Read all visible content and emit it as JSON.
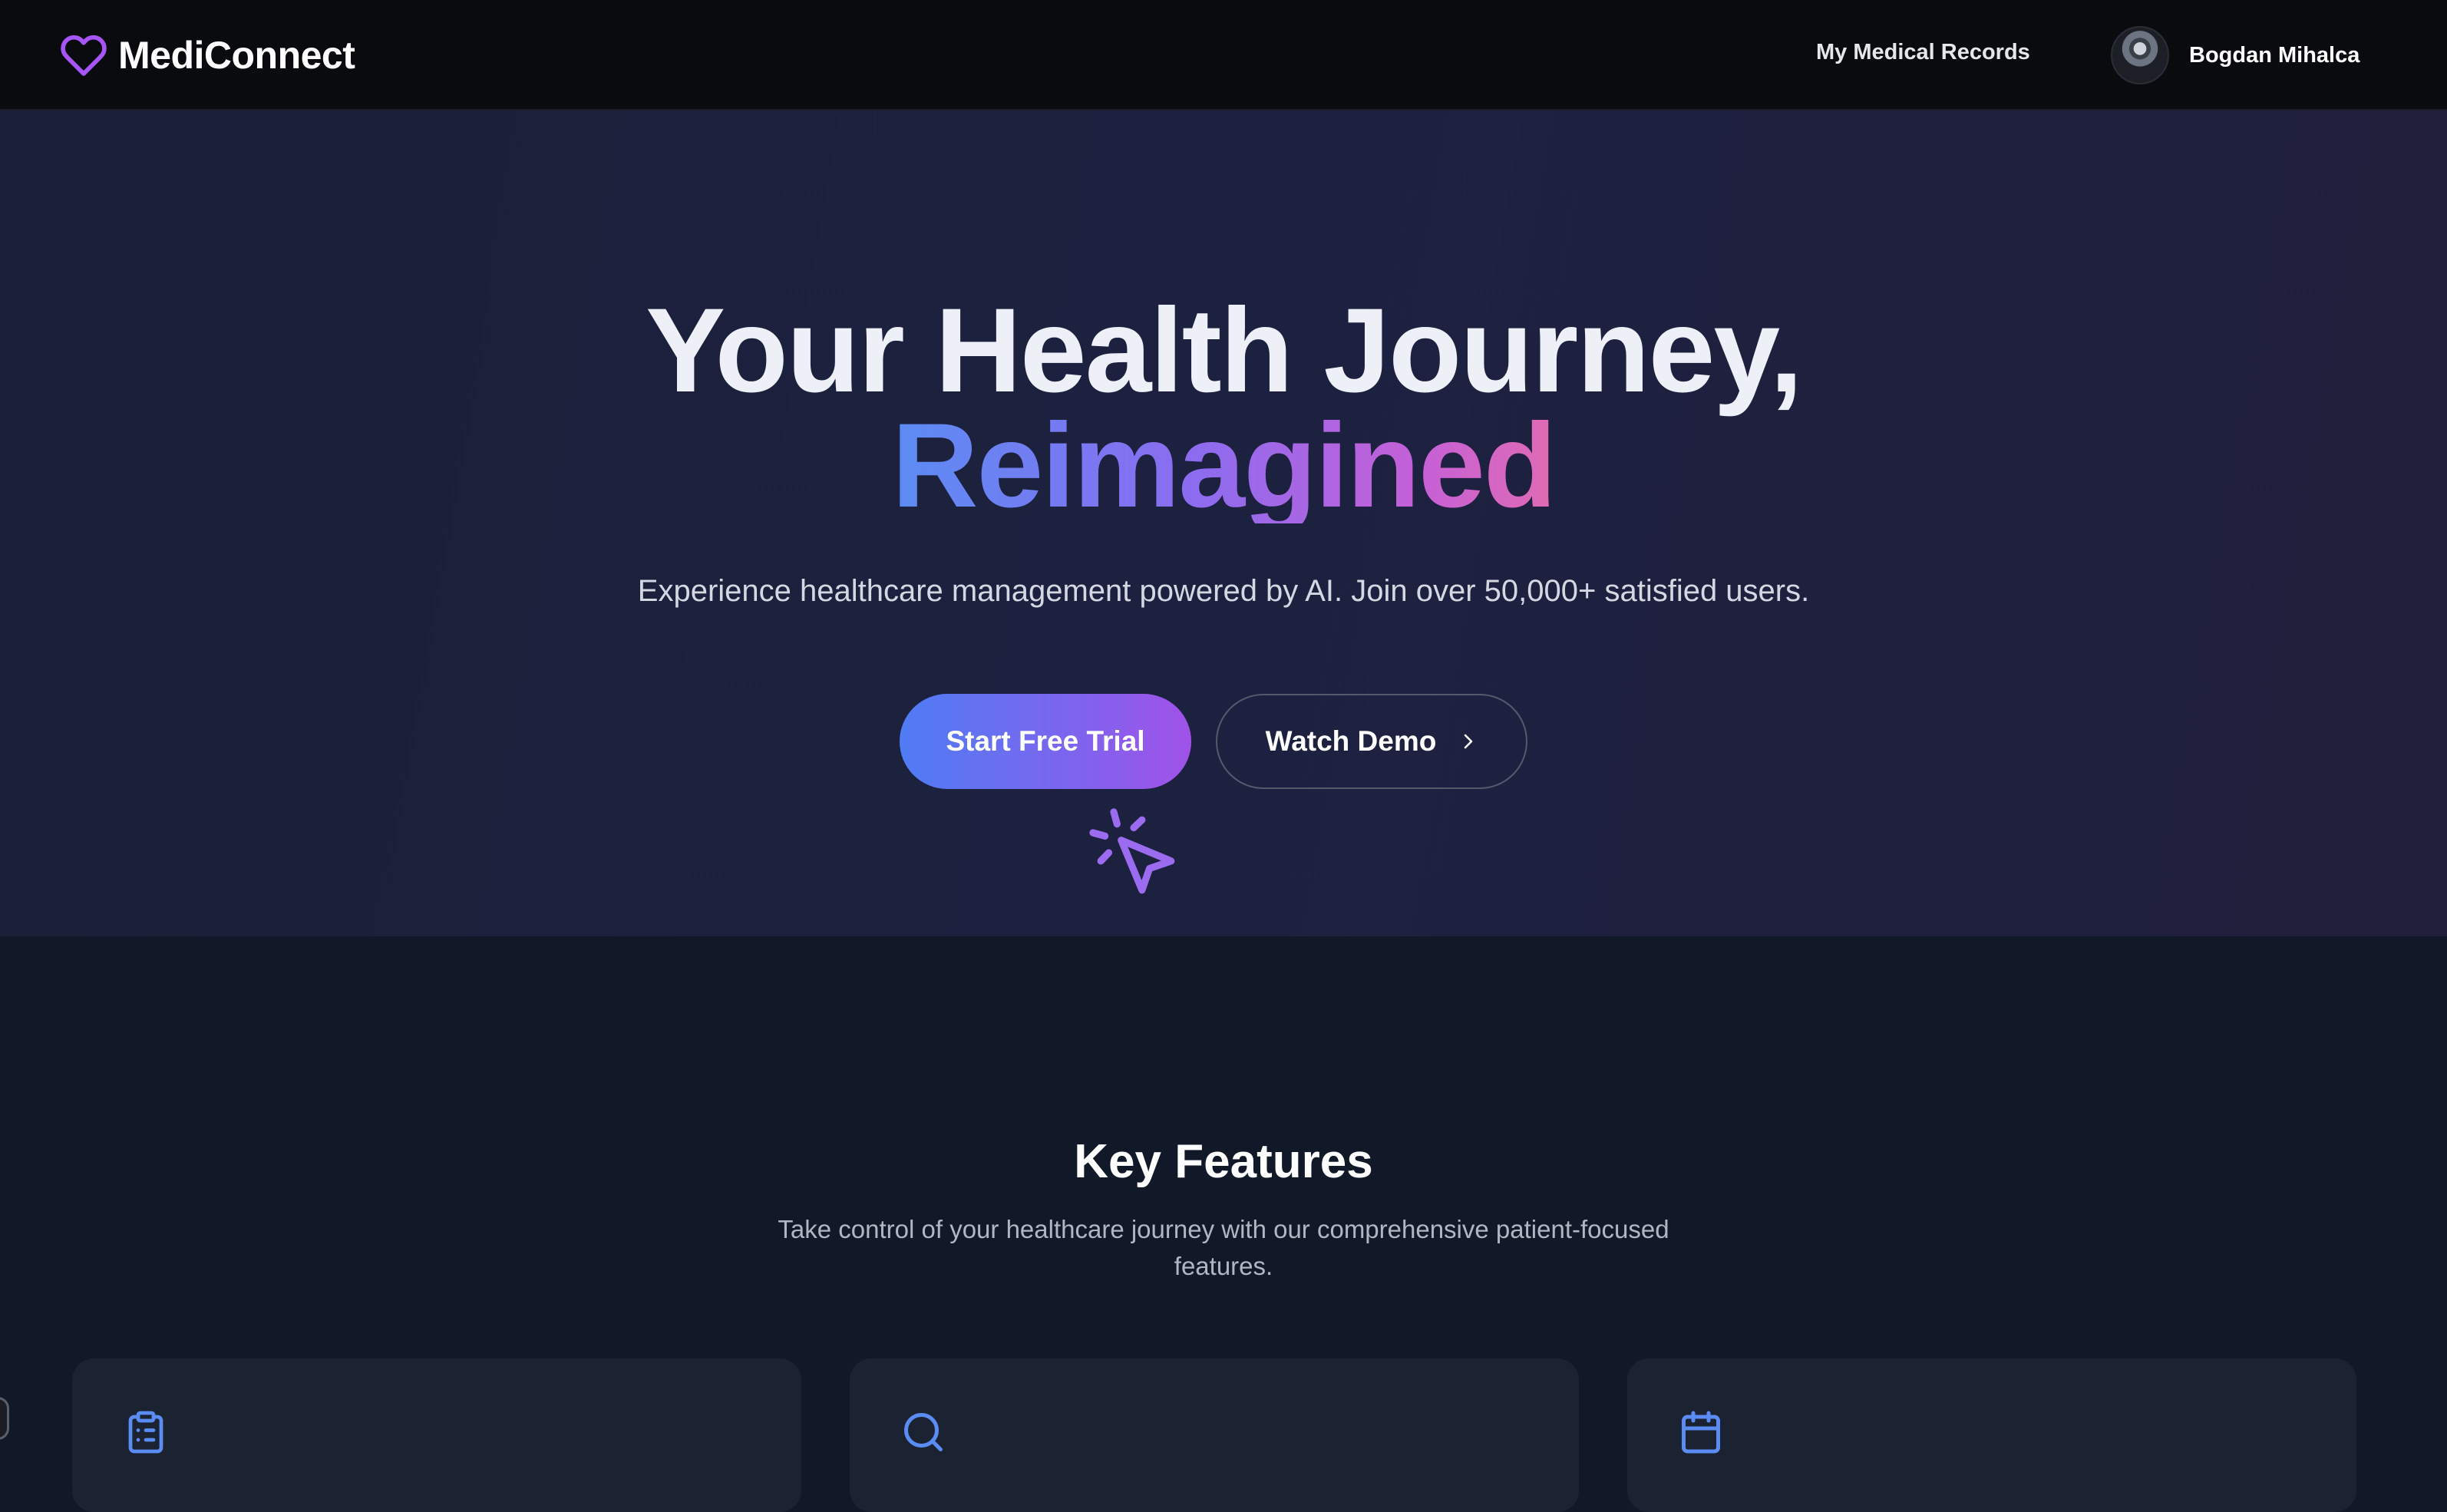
{
  "navbar": {
    "brand_name": "MediConnect",
    "brand_icon": "heart-icon",
    "nav_link": "My Medical Records",
    "user_name": "Bogdan Mihalca"
  },
  "hero": {
    "title_line1": "Your Health Journey,",
    "title_line2": "Reimagined",
    "subtitle": "Experience healthcare management powered by AI. Join over 50,000+ satisfied users.",
    "primary_button": "Start Free Trial",
    "secondary_button": "Watch Demo"
  },
  "features": {
    "title": "Key Features",
    "subtitle": "Take control of your healthcare journey with our comprehensive patient-focused features.",
    "cards": [
      {
        "icon": "clipboard-list-icon"
      },
      {
        "icon": "search-icon"
      },
      {
        "icon": "calendar-icon"
      }
    ]
  },
  "colors": {
    "accent_purple": "#a855f7",
    "accent_blue": "#5b8cf4",
    "accent_pink": "#e06bb3",
    "navbar_bg": "#0a0b0e",
    "page_bg": "#111827",
    "card_bg": "#1b2231"
  }
}
